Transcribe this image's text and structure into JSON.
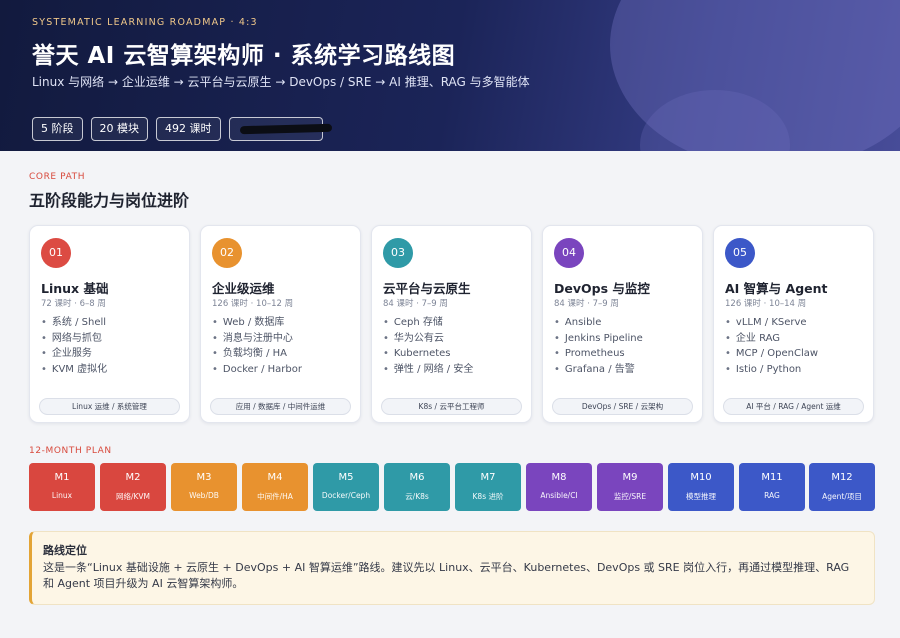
{
  "header": {
    "eyebrow": "SYSTEMATIC LEARNING ROADMAP · 4:3",
    "title": "誉天 AI 云智算架构师 · 系统学习路线图",
    "subtitle": "Linux 与网络 → 企业运维 → 云平台与云原生 → DevOps / SRE → AI 推理、RAG 与多智能体",
    "pills": [
      "5 阶段",
      "20 模块",
      "492 课时"
    ]
  },
  "core_path": {
    "eyebrow": "CORE PATH",
    "title": "五阶段能力与岗位进阶"
  },
  "stages": [
    {
      "num": "01",
      "color": "#dc4b43",
      "title": "Linux 基础",
      "meta": "72 课时 · 6–8 周",
      "items": [
        "系统 / Shell",
        "网络与抓包",
        "企业服务",
        "KVM 虚拟化"
      ],
      "tag": "Linux 运维 / 系统管理"
    },
    {
      "num": "02",
      "color": "#e8922f",
      "title": "企业级运维",
      "meta": "126 课时 · 10–12 周",
      "items": [
        "Web / 数据库",
        "消息与注册中心",
        "负载均衡 / HA",
        "Docker / Harbor"
      ],
      "tag": "应用 / 数据库 / 中间件运维"
    },
    {
      "num": "03",
      "color": "#2f9aa7",
      "title": "云平台与云原生",
      "meta": "84 课时 · 7–9 周",
      "items": [
        "Ceph 存储",
        "华为公有云",
        "Kubernetes",
        "弹性 / 网络 / 安全"
      ],
      "tag": "K8s / 云平台工程师"
    },
    {
      "num": "04",
      "color": "#7a45be",
      "title": "DevOps 与监控",
      "meta": "84 课时 · 7–9 周",
      "items": [
        "Ansible",
        "Jenkins Pipeline",
        "Prometheus",
        "Grafana / 告警"
      ],
      "tag": "DevOps / SRE / 云架构"
    },
    {
      "num": "05",
      "color": "#3c58c8",
      "title": "AI 智算与 Agent",
      "meta": "126 课时 · 10–14 周",
      "items": [
        "vLLM / KServe",
        "企业 RAG",
        "MCP / OpenClaw",
        "Istio / Python"
      ],
      "tag": "AI 平台 / RAG / Agent 运维"
    }
  ],
  "plan": {
    "eyebrow": "12-MONTH PLAN",
    "months": [
      {
        "code": "M1",
        "label": "Linux",
        "color": "#d9473f"
      },
      {
        "code": "M2",
        "label": "网络/KVM",
        "color": "#d9473f"
      },
      {
        "code": "M3",
        "label": "Web/DB",
        "color": "#e8922f"
      },
      {
        "code": "M4",
        "label": "中间件/HA",
        "color": "#e8922f"
      },
      {
        "code": "M5",
        "label": "Docker/Ceph",
        "color": "#2f9aa7"
      },
      {
        "code": "M6",
        "label": "云/K8s",
        "color": "#2f9aa7"
      },
      {
        "code": "M7",
        "label": "K8s 进阶",
        "color": "#2f9aa7"
      },
      {
        "code": "M8",
        "label": "Ansible/CI",
        "color": "#7a45be"
      },
      {
        "code": "M9",
        "label": "监控/SRE",
        "color": "#7a45be"
      },
      {
        "code": "M10",
        "label": "模型推理",
        "color": "#3c58c8"
      },
      {
        "code": "M11",
        "label": "RAG",
        "color": "#3c58c8"
      },
      {
        "code": "M12",
        "label": "Agent/项目",
        "color": "#3c58c8"
      }
    ]
  },
  "note": {
    "title": "路线定位",
    "text": "这是一条“Linux 基础设施 + 云原生 + DevOps + AI 智算运维”路线。建议先以 Linux、云平台、Kubernetes、DevOps 或 SRE 岗位入行，再通过模型推理、RAG 和 Agent 项目升级为 AI 云智算架构师。"
  }
}
